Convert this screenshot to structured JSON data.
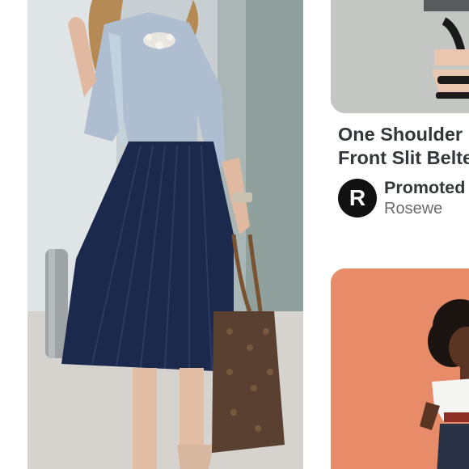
{
  "feed": {
    "pins": [
      {
        "image": "woman-pleated-navy-skirt-photo"
      },
      {
        "image": "black-sandal-shoe-photo",
        "title_lines": [
          "One Shoulder",
          "Front Slit Belte"
        ],
        "promoted_label": "Promoted",
        "advertiser": "Rosewe",
        "avatar_letter": "R"
      },
      {
        "image": "woman-white-shirt-orange-background-photo"
      }
    ]
  },
  "colors": {
    "skirt": "#1b2a4c",
    "orange_background": "#e88b69",
    "title_text": "#33373b",
    "secondary_text": "#6b6b6b"
  }
}
